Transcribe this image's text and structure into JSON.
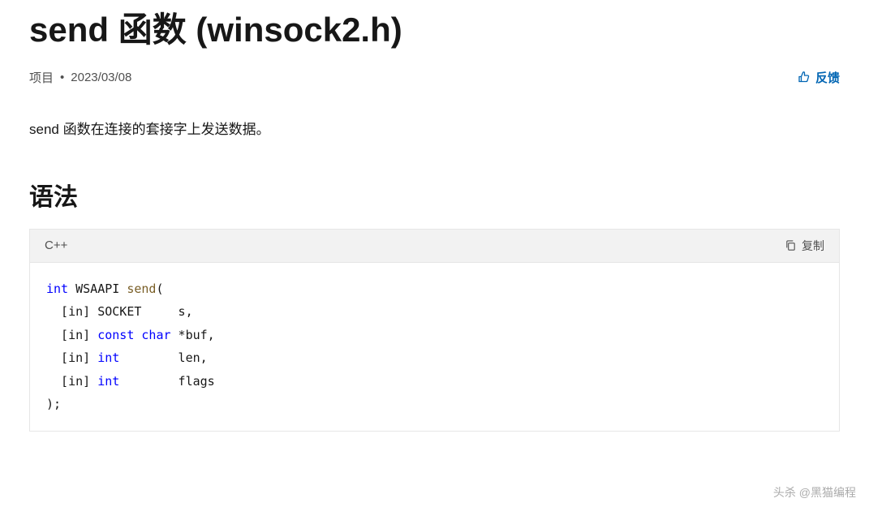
{
  "title": "send 函数 (winsock2.h)",
  "meta": {
    "label": "项目",
    "separator": " • ",
    "date": "2023/03/08"
  },
  "feedback": {
    "label": "反馈"
  },
  "description": "send 函数在连接的套接字上发送数据。",
  "syntaxHeading": "语法",
  "codeBlock": {
    "language": "C++",
    "copyLabel": "复制",
    "tokens": {
      "int": "int",
      "wsaapi": "WSAAPI ",
      "send": "send",
      "open": "(",
      "l1a": "  [in] SOCKET     s,",
      "l2a": "  [in] ",
      "const": "const",
      "sp1": " ",
      "char": "char",
      "l2b": " *buf,",
      "l3a": "  [in] ",
      "l3b": "        len,",
      "l4a": "  [in] ",
      "l4b": "        flags",
      "close": ");"
    }
  },
  "watermark": "头杀 @黑猫编程"
}
